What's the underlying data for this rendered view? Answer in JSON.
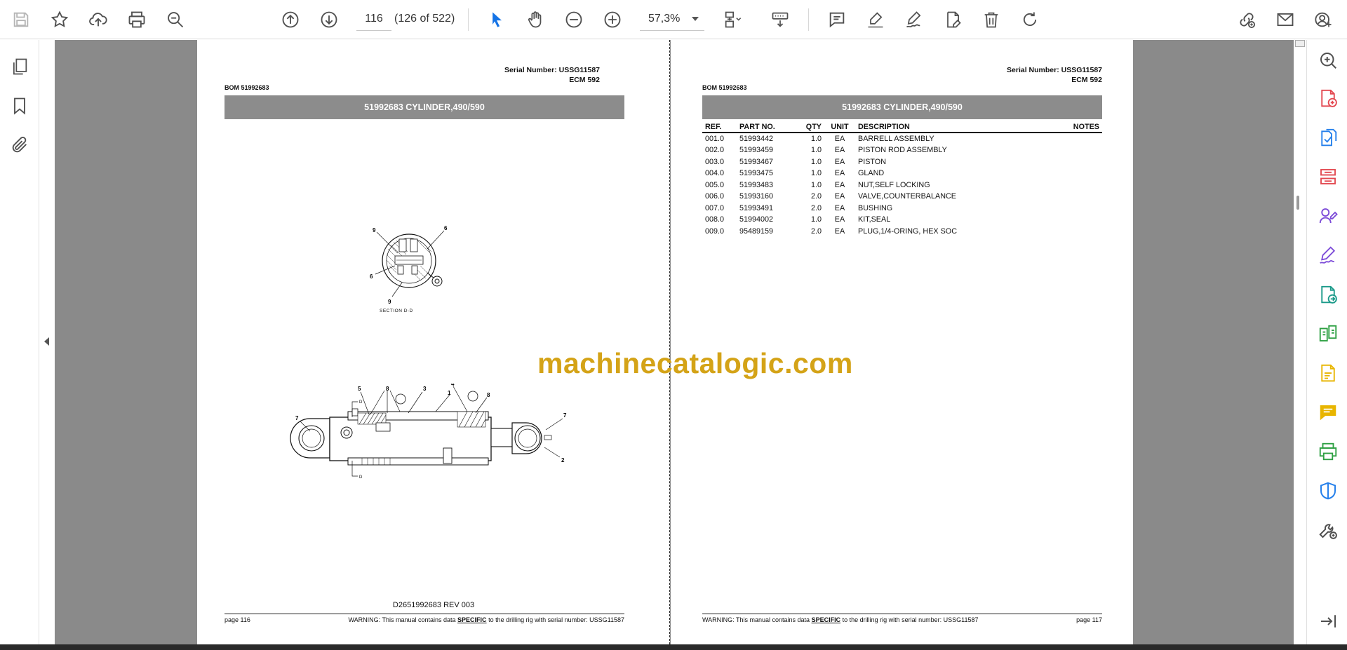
{
  "toolbar": {
    "page_current": "116",
    "page_count_label": "(126 of 522)",
    "zoom_value": "57,3%",
    "icons": [
      "save-icon",
      "bookmark-star-icon",
      "upload-cloud-icon",
      "print-icon",
      "zoom-search-icon",
      "page-up-icon",
      "page-down-icon",
      "select-cursor-icon",
      "hand-pan-icon",
      "zoom-out-icon",
      "zoom-in-icon",
      "fit-page-icon",
      "scroll-mode-icon",
      "comment-icon",
      "highlight-icon",
      "draw-sign-icon",
      "edit-text-icon",
      "delete-icon",
      "rotate-icon",
      "share-link-icon",
      "mail-icon",
      "user-add-icon"
    ]
  },
  "left_rail": {
    "icons": [
      "pages-icon",
      "bookmarks-icon",
      "attachments-icon"
    ]
  },
  "right_rail": {
    "icons": [
      "search-zoom-icon",
      "create-pdf-icon",
      "export-pdf-icon",
      "organize-pages-icon",
      "request-signature-icon",
      "fill-sign-icon",
      "send-file-icon",
      "compare-files-icon",
      "edit-pdf-icon",
      "comment-tool-icon",
      "print-production-icon",
      "protect-shield-icon",
      "more-tools-icon",
      "expand-panel-icon"
    ]
  },
  "colors": {
    "accent": "#1473e6",
    "title_bar": "#8c8c8c",
    "watermark": "#d4a317",
    "red_tool": "#e34850",
    "purple_tool": "#7d4cd8",
    "teal_tool": "#1c9a8a",
    "green_tool": "#2ea043",
    "yellow_tool": "#e8b500",
    "blue_tool": "#2680eb"
  },
  "left_page": {
    "serial_line1": "Serial Number: USSG11587",
    "serial_line2": "ECM 592",
    "bom_label": "BOM 51992683",
    "title": "51992683 CYLINDER,490/590",
    "section_label": "SECTION D-D",
    "callouts_section": [
      "9",
      "6",
      "6",
      "9"
    ],
    "callouts_main": [
      "5",
      "8",
      "3",
      "4",
      "1",
      "8",
      "7",
      "7",
      "2"
    ],
    "section_marks": [
      "D",
      "D"
    ],
    "drawing_number": "D2651992683 REV 003",
    "footer_page": "page 116",
    "footer_warning_pre": "WARNING:  This manual contains data ",
    "footer_warning_em": "SPECIFIC",
    "footer_warning_post": " to the drilling rig with serial number: USSG11587"
  },
  "right_page": {
    "serial_line1": "Serial Number: USSG11587",
    "serial_line2": "ECM 592",
    "bom_label": "BOM 51992683",
    "title": "51992683 CYLINDER,490/590",
    "table_headers": {
      "ref": "REF.",
      "part": "PART NO.",
      "qty": "QTY",
      "unit": "UNIT",
      "desc": "DESCRIPTION",
      "notes": "NOTES"
    },
    "rows": [
      {
        "ref": "001.0",
        "part": "51993442",
        "qty": "1.0",
        "unit": "EA",
        "desc": "BARRELL ASSEMBLY"
      },
      {
        "ref": "002.0",
        "part": "51993459",
        "qty": "1.0",
        "unit": "EA",
        "desc": "PISTON ROD ASSEMBLY"
      },
      {
        "ref": "003.0",
        "part": "51993467",
        "qty": "1.0",
        "unit": "EA",
        "desc": "PISTON"
      },
      {
        "ref": "004.0",
        "part": "51993475",
        "qty": "1.0",
        "unit": "EA",
        "desc": "GLAND"
      },
      {
        "ref": "005.0",
        "part": "51993483",
        "qty": "1.0",
        "unit": "EA",
        "desc": "NUT,SELF LOCKING"
      },
      {
        "ref": "006.0",
        "part": "51993160",
        "qty": "2.0",
        "unit": "EA",
        "desc": "VALVE,COUNTERBALANCE"
      },
      {
        "ref": "007.0",
        "part": "51993491",
        "qty": "2.0",
        "unit": "EA",
        "desc": "BUSHING"
      },
      {
        "ref": "008.0",
        "part": "51994002",
        "qty": "1.0",
        "unit": "EA",
        "desc": "KIT,SEAL"
      },
      {
        "ref": "009.0",
        "part": "95489159",
        "qty": "2.0",
        "unit": "EA",
        "desc": "PLUG,1/4-ORING, HEX SOC"
      }
    ],
    "footer_page": "page 117",
    "footer_warning_pre": "WARNING:  This manual contains data ",
    "footer_warning_em": "SPECIFIC",
    "footer_warning_post": " to the drilling rig with serial number: USSG11587"
  },
  "watermark": "machinecatalogic.com"
}
